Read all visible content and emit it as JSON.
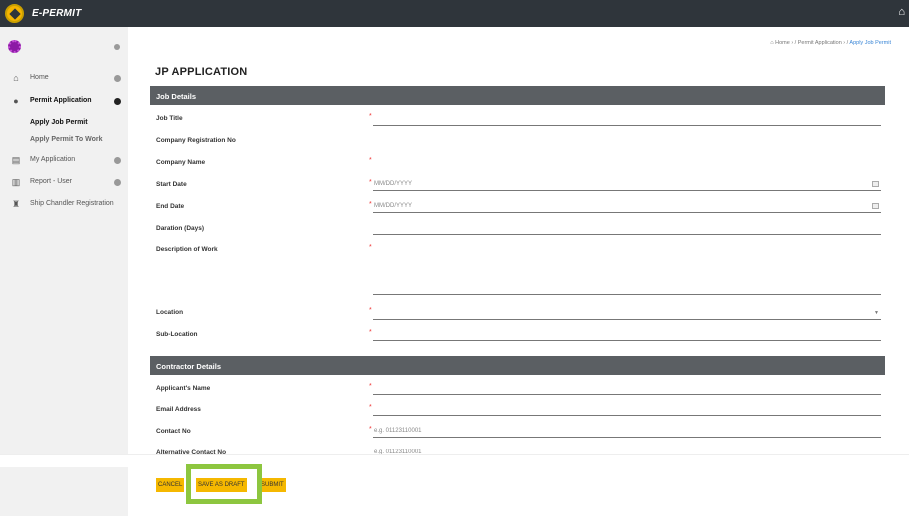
{
  "app": {
    "brand": "E-PERMIT"
  },
  "sidebar": {
    "items": [
      {
        "label": "Home",
        "icon": "home-icon"
      },
      {
        "label": "Permit Application",
        "icon": "circle-icon"
      },
      {
        "label": "My Application",
        "icon": "document-icon"
      },
      {
        "label": "Report - User",
        "icon": "chart-icon"
      },
      {
        "label": "Ship Chandler Registration",
        "icon": "ship-icon"
      }
    ],
    "subitems": [
      {
        "label": "Apply Job Permit"
      },
      {
        "label": "Apply Permit To Work"
      }
    ]
  },
  "breadcrumb": {
    "home": "Home",
    "sep1": " › / ",
    "permit": "Permit Application",
    "sep2": " › / ",
    "current": "Apply Job Permit"
  },
  "page": {
    "title": "JP APPLICATION"
  },
  "sections": {
    "job": "Job Details",
    "contractor": "Contractor Details"
  },
  "fields": {
    "job_title": {
      "label": "Job Title"
    },
    "company_reg": {
      "label": "Company Registration No"
    },
    "company_name": {
      "label": "Company Name"
    },
    "start_date": {
      "label": "Start Date",
      "placeholder": "MM/DD/YYYY"
    },
    "end_date": {
      "label": "End Date",
      "placeholder": "MM/DD/YYYY"
    },
    "duration": {
      "label": "Daration (Days)"
    },
    "description": {
      "label": "Description of Work"
    },
    "location": {
      "label": "Location"
    },
    "sublocation": {
      "label": "Sub-Location"
    },
    "applicant": {
      "label": "Applicant's Name"
    },
    "email": {
      "label": "Email Address"
    },
    "contact": {
      "label": "Contact No",
      "placeholder": "e.g. 01123110001"
    },
    "alt_contact": {
      "label": "Alternative Contact No",
      "placeholder": "e.g. 01123110001"
    }
  },
  "required_mark": "*",
  "buttons": {
    "cancel": "CANCEL",
    "draft": "SAVE AS DRAFT",
    "submit": "SUBMIT"
  },
  "colors": {
    "topbar": "#2f353b",
    "accent": "#f5b800",
    "section_header": "#5b5f63",
    "highlight": "#8dc63f",
    "link": "#3a86d6"
  }
}
